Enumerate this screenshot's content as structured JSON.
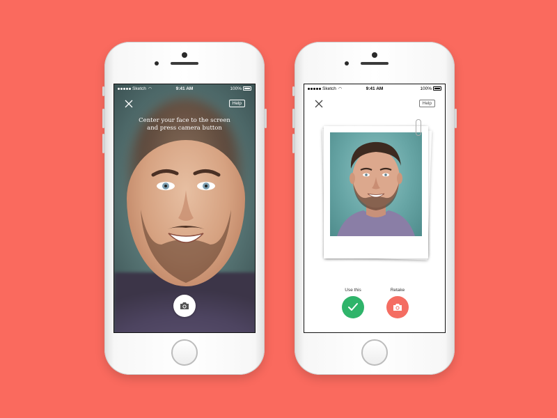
{
  "colors": {
    "background": "#fa6a5e",
    "use_button": "#2fb46a",
    "retake_button": "#f46d62"
  },
  "status_bar": {
    "carrier": "Sketch",
    "time": "9:41 AM",
    "battery": "100%"
  },
  "camera_screen": {
    "close_icon": "close-icon",
    "help_label": "Help",
    "instruction_line1": "Center your face to the screen",
    "instruction_line2": "and press camera button",
    "shutter_icon": "camera-icon"
  },
  "review_screen": {
    "close_icon": "close-icon",
    "help_label": "Help",
    "use_label": "Use this",
    "use_icon": "checkmark-icon",
    "retake_label": "Retake",
    "retake_icon": "camera-icon"
  }
}
